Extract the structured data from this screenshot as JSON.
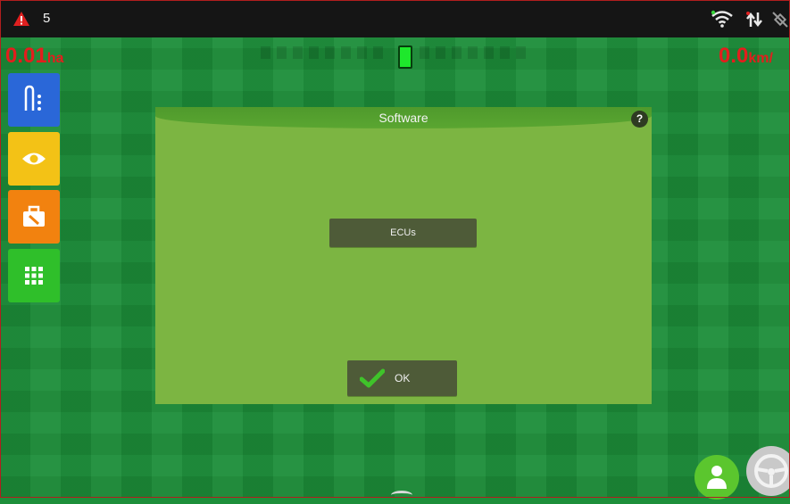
{
  "status_bar": {
    "alarm_icon": "warning-triangle-icon",
    "alarm_count": "5",
    "icons": [
      "wifi-icon",
      "data-transfer-icon",
      "gps-off-icon"
    ]
  },
  "readouts": {
    "area_value": "0.01",
    "area_unit": "ha",
    "speed_value": "0.0",
    "speed_unit": "km/"
  },
  "side_menu": [
    {
      "icon": "implement-icon",
      "color": "#2a67d8"
    },
    {
      "icon": "eye-icon",
      "color": "#f3c216"
    },
    {
      "icon": "toolbox-icon",
      "color": "#f2820f"
    },
    {
      "icon": "apps-grid-icon",
      "color": "#2fbf2a"
    }
  ],
  "dialog": {
    "title": "Software",
    "help_label": "?",
    "ecus_button_label": "ECUs",
    "ok_button_label": "OK"
  },
  "colors": {
    "field_green": "#1c8e39",
    "dialog_green": "#7cb542",
    "button_dark": "#4e5b38",
    "alert_red": "#e41d1d"
  }
}
